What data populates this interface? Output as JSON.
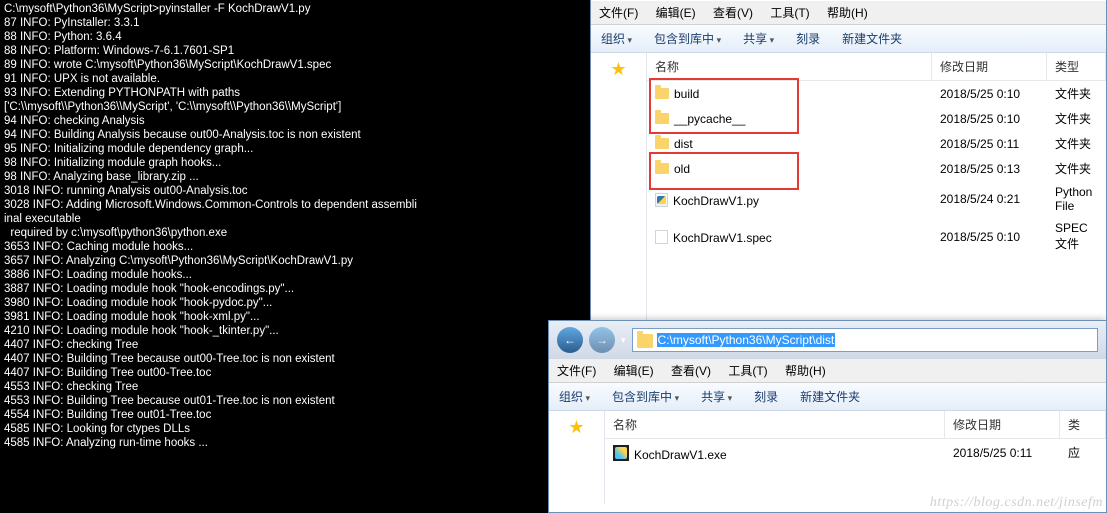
{
  "terminal": {
    "lines": [
      "C:\\mysoft\\Python36\\MyScript>pyinstaller -F KochDrawV1.py",
      "87 INFO: PyInstaller: 3.3.1",
      "88 INFO: Python: 3.6.4",
      "88 INFO: Platform: Windows-7-6.1.7601-SP1",
      "89 INFO: wrote C:\\mysoft\\Python36\\MyScript\\KochDrawV1.spec",
      "91 INFO: UPX is not available.",
      "93 INFO: Extending PYTHONPATH with paths",
      "['C:\\\\mysoft\\\\Python36\\\\MyScript', 'C:\\\\mysoft\\\\Python36\\\\MyScript']",
      "94 INFO: checking Analysis",
      "94 INFO: Building Analysis because out00-Analysis.toc is non existent",
      "95 INFO: Initializing module dependency graph...",
      "98 INFO: Initializing module graph hooks...",
      "98 INFO: Analyzing base_library.zip ...",
      "3018 INFO: running Analysis out00-Analysis.toc",
      "3028 INFO: Adding Microsoft.Windows.Common-Controls to dependent assembli",
      "inal executable",
      "  required by c:\\mysoft\\python36\\python.exe",
      "3653 INFO: Caching module hooks...",
      "3657 INFO: Analyzing C:\\mysoft\\Python36\\MyScript\\KochDrawV1.py",
      "3886 INFO: Loading module hooks...",
      "3887 INFO: Loading module hook \"hook-encodings.py\"...",
      "3980 INFO: Loading module hook \"hook-pydoc.py\"...",
      "3981 INFO: Loading module hook \"hook-xml.py\"...",
      "4210 INFO: Loading module hook \"hook-_tkinter.py\"...",
      "4407 INFO: checking Tree",
      "4407 INFO: Building Tree because out00-Tree.toc is non existent",
      "4407 INFO: Building Tree out00-Tree.toc",
      "4553 INFO: checking Tree",
      "4553 INFO: Building Tree because out01-Tree.toc is non existent",
      "4554 INFO: Building Tree out01-Tree.toc",
      "4585 INFO: Looking for ctypes DLLs",
      "4585 INFO: Analyzing run-time hooks ..."
    ]
  },
  "explorer1": {
    "menu": {
      "file": "文件(F)",
      "edit": "编辑(E)",
      "view": "查看(V)",
      "tools": "工具(T)",
      "help": "帮助(H)"
    },
    "toolbar": {
      "organize": "组织",
      "include": "包含到库中",
      "share": "共享",
      "burn": "刻录",
      "newfolder": "新建文件夹"
    },
    "headers": {
      "name": "名称",
      "date": "修改日期",
      "type": "类型"
    },
    "files": [
      {
        "icon": "folder",
        "name": "build",
        "date": "2018/5/25 0:10",
        "type": "文件夹"
      },
      {
        "icon": "folder",
        "name": "__pycache__",
        "date": "2018/5/25 0:10",
        "type": "文件夹"
      },
      {
        "icon": "folder",
        "name": "dist",
        "date": "2018/5/25 0:11",
        "type": "文件夹"
      },
      {
        "icon": "folder",
        "name": "old",
        "date": "2018/5/25 0:13",
        "type": "文件夹"
      },
      {
        "icon": "py",
        "name": "KochDrawV1.py",
        "date": "2018/5/24 0:21",
        "type": "Python File"
      },
      {
        "icon": "spec",
        "name": "KochDrawV1.spec",
        "date": "2018/5/25 0:10",
        "type": "SPEC 文件"
      }
    ]
  },
  "explorer2": {
    "address": "C:\\mysoft\\Python36\\MyScript\\dist",
    "menu": {
      "file": "文件(F)",
      "edit": "编辑(E)",
      "view": "查看(V)",
      "tools": "工具(T)",
      "help": "帮助(H)"
    },
    "toolbar": {
      "organize": "组织",
      "include": "包含到库中",
      "share": "共享",
      "burn": "刻录",
      "newfolder": "新建文件夹"
    },
    "headers": {
      "name": "名称",
      "date": "修改日期",
      "type": "类"
    },
    "files": [
      {
        "icon": "exe",
        "name": "KochDrawV1.exe",
        "date": "2018/5/25 0:11",
        "type": "应"
      }
    ]
  },
  "watermark": "https://blog.csdn.net/jinsefm"
}
